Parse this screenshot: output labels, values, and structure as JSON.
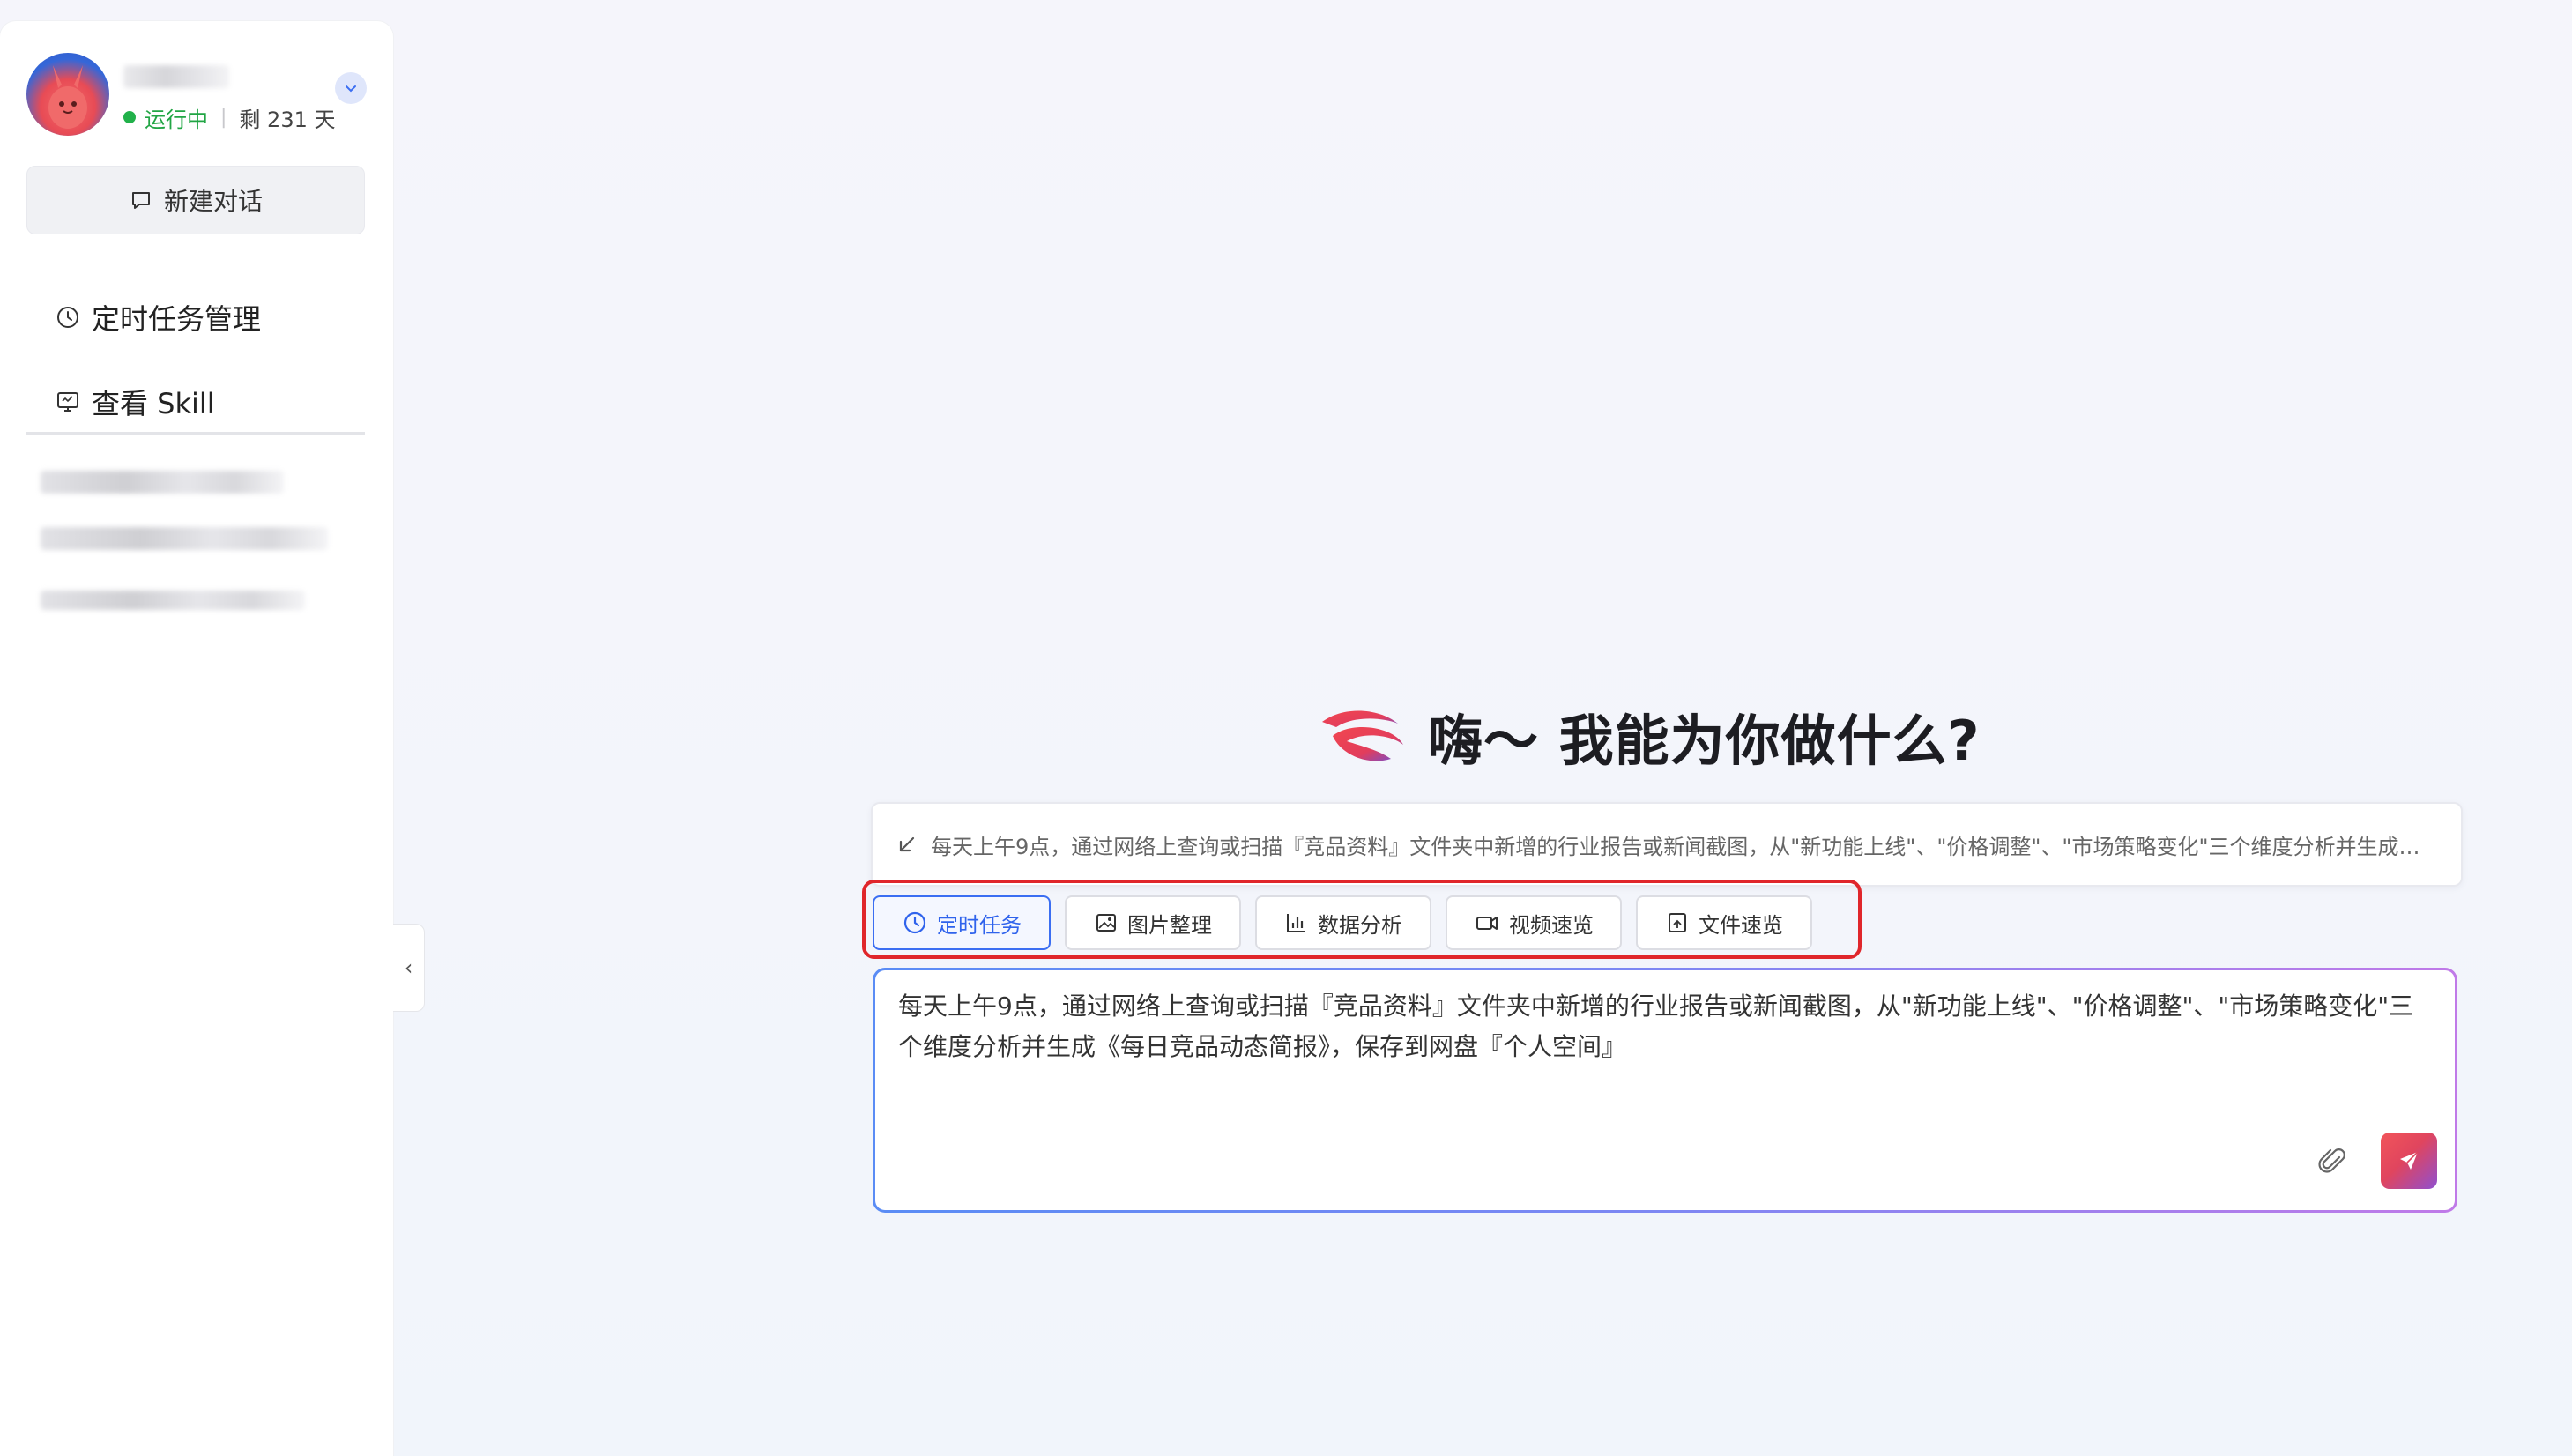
{
  "sidebar": {
    "status_running": "运行中",
    "status_separator": "|",
    "status_days": "剩 231 天",
    "new_chat_label": "新建对话",
    "nav": [
      {
        "label": "定时任务管理",
        "icon": "clock-icon"
      },
      {
        "label": "查看 Skill",
        "icon": "monitor-icon"
      }
    ],
    "collapse_glyph": "‹"
  },
  "main": {
    "greeting": "嗨～ 我能为你做什么?",
    "hint": "每天上午9点，通过网络上查询或扫描『竞品资料』文件夹中新增的行业报告或新闻截图，从\"新功能上线\"、\"价格调整\"、\"市场策略变化\"三个维度分析并生成《…",
    "chips": [
      {
        "label": "定时任务",
        "icon": "clock-icon",
        "active": true
      },
      {
        "label": "图片整理",
        "icon": "image-icon",
        "active": false
      },
      {
        "label": "数据分析",
        "icon": "bar-chart-icon",
        "active": false
      },
      {
        "label": "视频速览",
        "icon": "video-icon",
        "active": false
      },
      {
        "label": "文件速览",
        "icon": "file-icon",
        "active": false
      }
    ],
    "input_value": "每天上午9点，通过网络上查询或扫描『竞品资料』文件夹中新增的行业报告或新闻截图，从\"新功能上线\"、\"价格调整\"、\"市场策略变化\"三个维度分析并生成《每日竞品动态简报》，保存到网盘『个人空间』"
  },
  "colors": {
    "accent_blue": "#3b6ef2",
    "status_green": "#21a544",
    "highlight_red": "#e0262b",
    "send_gradient_start": "#f2555a",
    "send_gradient_end": "#8f4fd0"
  }
}
